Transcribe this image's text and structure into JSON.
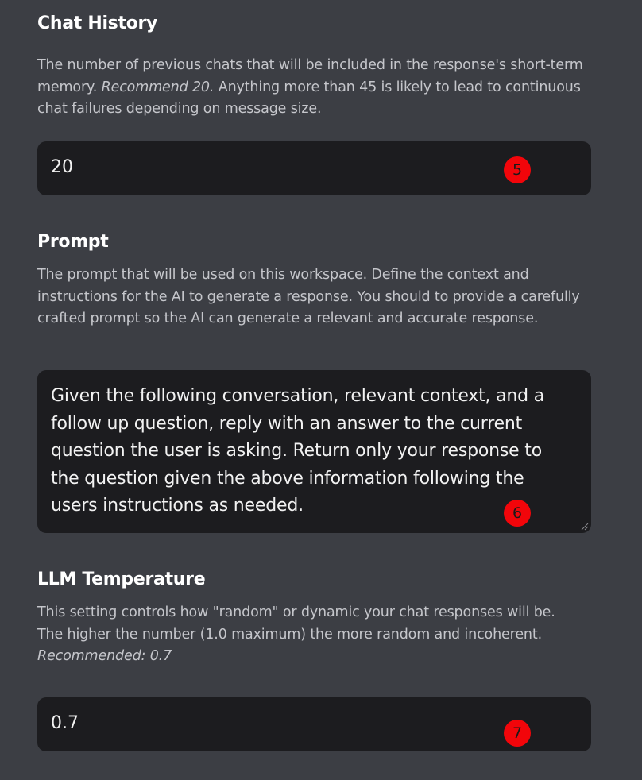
{
  "chat_history": {
    "title": "Chat History",
    "desc_part1": "The number of previous chats that will be included in the response's short-term memory.",
    "desc_emphasis": "Recommend 20.",
    "desc_part2": "Anything more than 45 is likely to lead to continuous chat failures depending on message size.",
    "value": "20",
    "badge": "5"
  },
  "prompt": {
    "title": "Prompt",
    "description": "The prompt that will be used on this workspace. Define the context and instructions for the AI to generate a response. You should to provide a carefully crafted prompt so the AI can generate a relevant and accurate response.",
    "value": "Given the following conversation, relevant context, and a follow up question, reply with an answer to the current question the user is asking. Return only your response to the question given the above information following the users instructions as needed.",
    "badge": "6"
  },
  "llm_temperature": {
    "title": "LLM Temperature",
    "desc_line1": "This setting controls how \"random\" or dynamic your chat responses will be.",
    "desc_line2": "The higher the number (1.0 maximum) the more random and incoherent.",
    "desc_recommended": "Recommended: 0.7",
    "value": "0.7",
    "badge": "7"
  },
  "colors": {
    "background": "#3c3e44",
    "field_background": "#1c1c1f",
    "badge": "#f2050a",
    "description_text": "#c5c6cb"
  }
}
